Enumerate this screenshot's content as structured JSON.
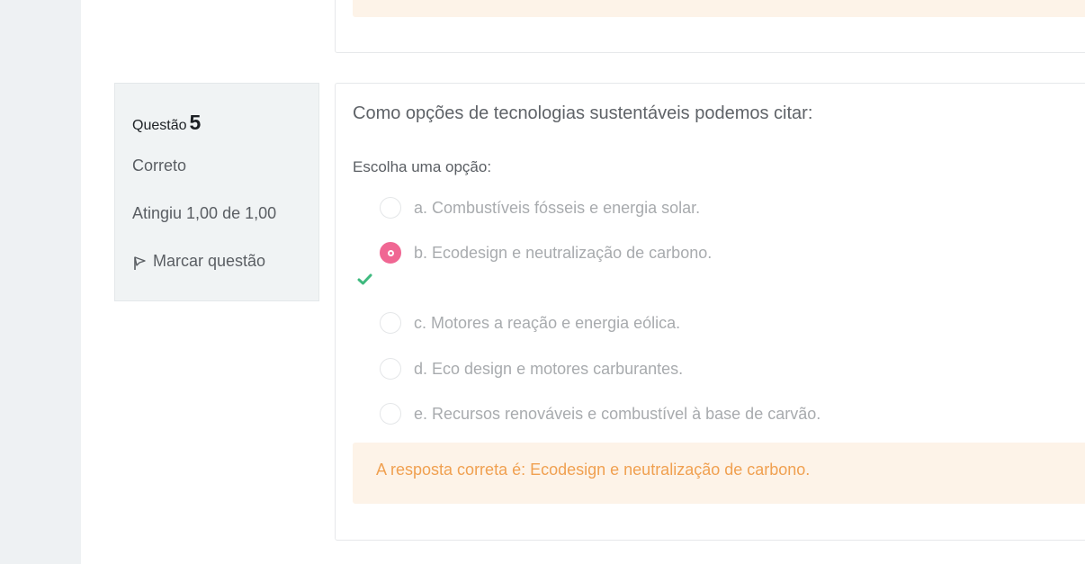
{
  "question": {
    "label": "Questão",
    "number": "5",
    "state": "Correto",
    "grade": "Atingiu 1,00 de 1,00",
    "flag_label": "Marcar questão",
    "text": "Como opções de tecnologias sustentáveis podemos citar:",
    "prompt": "Escolha uma opção:",
    "options": [
      {
        "label": "a. Combustíveis fósseis e energia solar.",
        "selected": false
      },
      {
        "label": "b. Ecodesign e neutralização de carbono.",
        "selected": true
      },
      {
        "label": "c. Motores a reação e energia eólica.",
        "selected": false
      },
      {
        "label": "d. Eco design e motores carburantes.",
        "selected": false
      },
      {
        "label": "e. Recursos renováveis e combustível à base de carvão.",
        "selected": false
      }
    ],
    "feedback": "A resposta correta é: Ecodesign e neutralização de carbono."
  },
  "colors": {
    "accent": "#f06793",
    "correct": "#3fba7f",
    "feedback_bg": "#fdf3e8",
    "feedback_text": "#f0a050"
  },
  "icons": {
    "flag": "flag-icon",
    "correct": "check-icon"
  }
}
